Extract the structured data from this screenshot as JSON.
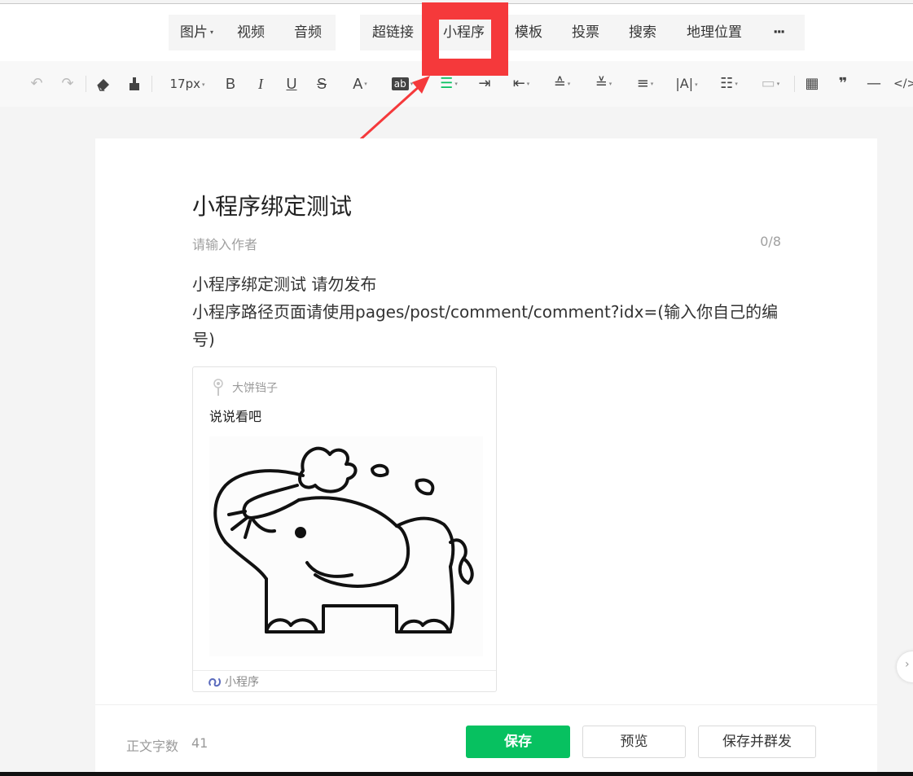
{
  "topnav": {
    "group1": [
      {
        "label": "图片",
        "has_dropdown": true
      },
      {
        "label": "视频"
      },
      {
        "label": "音频"
      }
    ],
    "group2": [
      {
        "label": "超链接"
      },
      {
        "label": "小程序"
      },
      {
        "label": "模板"
      },
      {
        "label": "投票"
      },
      {
        "label": "搜索"
      },
      {
        "label": "地理位置"
      },
      {
        "label": "···"
      }
    ]
  },
  "toolbar": {
    "font_size": "17px",
    "highlight_text": "ab",
    "code_text": "</>",
    "icons": [
      "undo-icon",
      "redo-icon",
      "eraser-icon",
      "format-painter-icon",
      "bold-icon",
      "italic-icon",
      "underline-icon",
      "strikethrough-icon",
      "font-color-icon",
      "background-color-icon",
      "align-justify-icon",
      "indent-icon",
      "outdent-icon",
      "paragraph-spacing-before-icon",
      "paragraph-spacing-after-icon",
      "line-height-icon",
      "letter-spacing-icon",
      "list-icon",
      "border-icon",
      "table-icon",
      "quote-icon",
      "divider-icon",
      "code-icon"
    ]
  },
  "highlight_color": "#f5393b",
  "article": {
    "title": "小程序绑定测试",
    "author_placeholder": "请输入作者",
    "author_count": "0/8",
    "body_lines": [
      "小程序绑定测试 请勿发布",
      "小程序路径页面请使用pages/post/comment/comment?idx=(输入你自己的编号)"
    ]
  },
  "miniprogram_card": {
    "name": "大饼铛子",
    "description": "说说看吧",
    "footer_label": "小程序",
    "image_icon": "elephant-drawing"
  },
  "footer": {
    "word_count_label": "正文字数",
    "word_count": "41",
    "save_label": "保存",
    "preview_label": "预览",
    "save_and_mass_label": "保存并群发"
  },
  "colors": {
    "accent_green": "#07c160",
    "toolbar_green": "#07c160"
  }
}
